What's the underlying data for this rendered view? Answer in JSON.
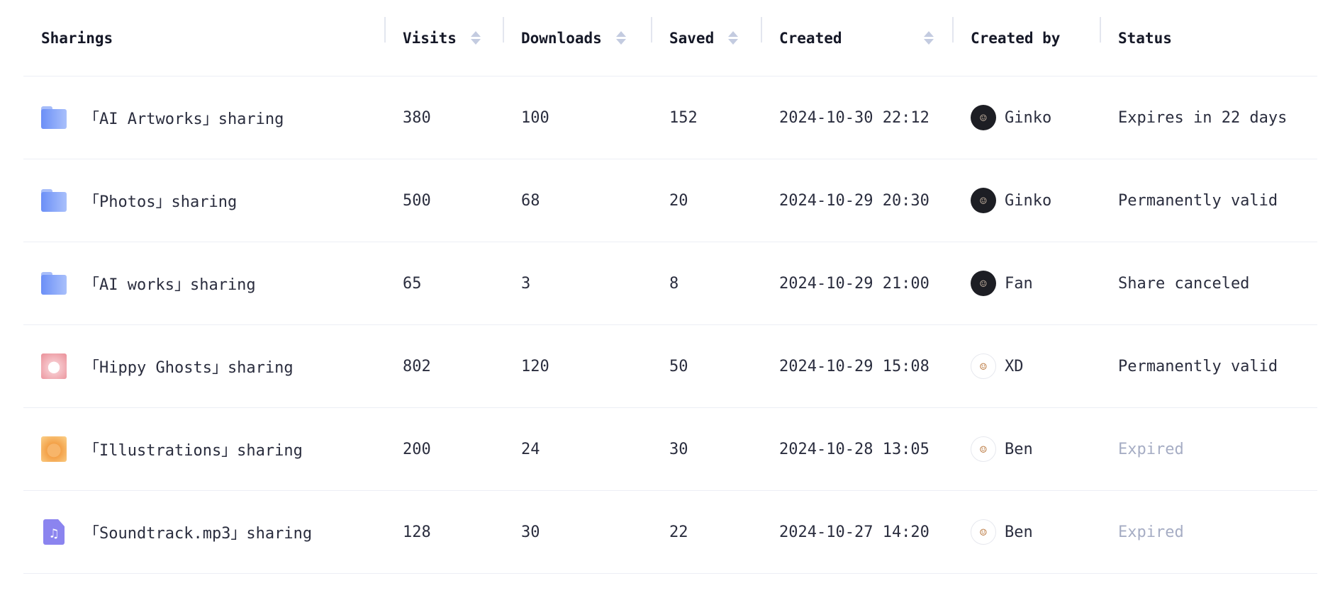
{
  "columns": {
    "sharings": "Sharings",
    "visits": "Visits",
    "downloads": "Downloads",
    "saved": "Saved",
    "created": "Created",
    "created_by": "Created by",
    "status": "Status"
  },
  "rows": [
    {
      "name": "「AI Artworks」sharing",
      "icon": "folder-icon",
      "visits": "380",
      "downloads": "100",
      "saved": "152",
      "created": "2024-10-30 22:12",
      "creator": "Ginko",
      "status": "Expires in 22 days",
      "expired": false
    },
    {
      "name": "「Photos」sharing",
      "icon": "folder-icon",
      "visits": "500",
      "downloads": "68",
      "saved": "20",
      "created": "2024-10-29 20:30",
      "creator": "Ginko",
      "status": "Permanently valid",
      "expired": false
    },
    {
      "name": "「AI works」sharing",
      "icon": "folder-icon",
      "visits": "65",
      "downloads": "3",
      "saved": "8",
      "created": "2024-10-29 21:00",
      "creator": "Fan",
      "status": "Share canceled",
      "expired": false
    },
    {
      "name": "「Hippy Ghosts」sharing",
      "icon": "ghost-thumbnail",
      "visits": "802",
      "downloads": "120",
      "saved": "50",
      "created": "2024-10-29 15:08",
      "creator": "XD",
      "status": "Permanently valid",
      "expired": false
    },
    {
      "name": "「Illustrations」sharing",
      "icon": "illustration-thumbnail",
      "visits": "200",
      "downloads": "24",
      "saved": "30",
      "created": "2024-10-28 13:05",
      "creator": "Ben",
      "status": "Expired",
      "expired": true
    },
    {
      "name": "「Soundtrack.mp3」sharing",
      "icon": "music-file-icon",
      "visits": "128",
      "downloads": "30",
      "saved": "22",
      "created": "2024-10-27 14:20",
      "creator": "Ben",
      "status": "Expired",
      "expired": true
    }
  ],
  "colors": {
    "accent_folder": "#6b8ff7",
    "muted": "#a6adc4",
    "text": "#2a2d3e",
    "music": "#8b84ef"
  }
}
